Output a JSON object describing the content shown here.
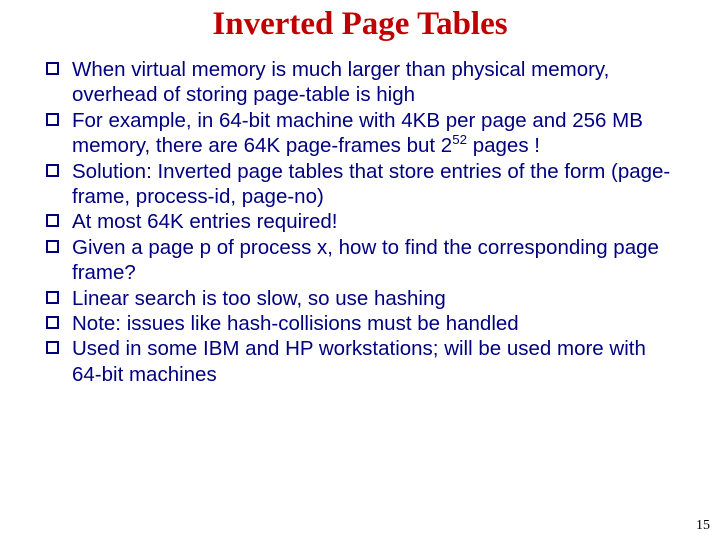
{
  "title": "Inverted Page Tables",
  "bullets": [
    {
      "pre": "When virtual memory is much larger than physical memory, overhead of storing page-table is high"
    },
    {
      "pre": "For example, in 64-bit machine with 4KB per page and 256 MB memory, there are 64K page-frames but 2",
      "supval": "52",
      "post": " pages !"
    },
    {
      "pre": "Solution: Inverted page tables that store entries of the form (page-frame, process-id, page-no)"
    },
    {
      "pre": "At most 64K entries required!"
    },
    {
      "pre": "Given a page p of process x, how to find the corresponding page frame?"
    },
    {
      "pre": "Linear search is too slow, so use hashing"
    },
    {
      "pre": "Note: issues like hash-collisions must be handled"
    },
    {
      "pre": "Used in some IBM and HP workstations; will be used more with 64-bit machines"
    }
  ],
  "page_number": "15"
}
